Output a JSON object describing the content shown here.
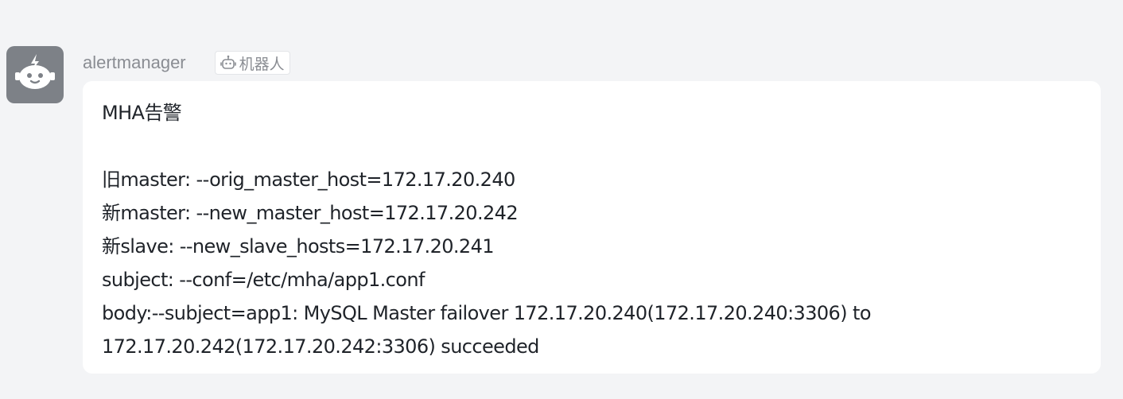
{
  "message": {
    "sender": "alertmanager",
    "badge_label": "机器人",
    "avatar_icon": "robot-icon",
    "badge_icon": "robot-outline-icon",
    "lines": [
      "MHA告警",
      "",
      "旧master: --orig_master_host=172.17.20.240",
      "新master: --new_master_host=172.17.20.242",
      "新slave: --new_slave_hosts=172.17.20.241",
      "subject: --conf=/etc/mha/app1.conf",
      "body:--subject=app1: MySQL Master failover 172.17.20.240(172.17.20.240:3306) to",
      "172.17.20.242(172.17.20.242:3306) succeeded"
    ]
  },
  "colors": {
    "background": "#f3f4f6",
    "avatar": "#7d8187",
    "bubble": "#ffffff",
    "text": "#1f2329",
    "muted": "#8a8d93"
  }
}
